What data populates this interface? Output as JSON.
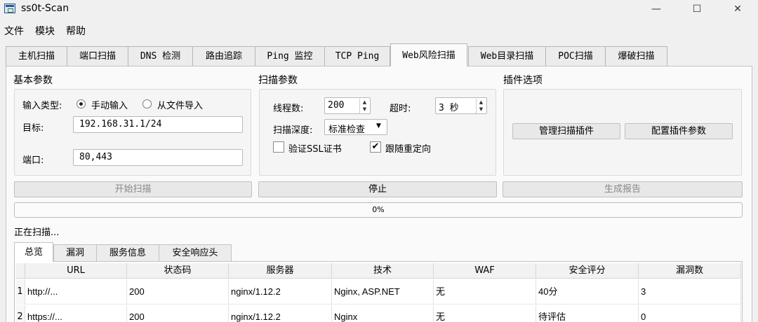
{
  "window": {
    "title": "ss0t-Scan"
  },
  "menu": [
    "文件",
    "模块",
    "帮助"
  ],
  "tabs": [
    "主机扫描",
    "端口扫描",
    "DNS 检测",
    "路由追踪",
    "Ping 监控",
    "TCP Ping",
    "Web风险扫描",
    "Web目录扫描",
    "POC扫描",
    "爆破扫描"
  ],
  "active_tab": "Web风险扫描",
  "basic": {
    "title": "基本参数",
    "input_type_label": "输入类型:",
    "radio_manual": "手动输入",
    "radio_file": "从文件导入",
    "target_label": "目标:",
    "target_value": "192.168.31.1/24",
    "port_label": "端口:",
    "port_value": "80,443"
  },
  "scan": {
    "title": "扫描参数",
    "threads_label": "线程数:",
    "threads_value": "200",
    "timeout_label": "超时:",
    "timeout_value": "3 秒",
    "depth_label": "扫描深度:",
    "depth_value": "标准检查",
    "verify_ssl_label": "验证SSL证书",
    "verify_ssl_checked": false,
    "follow_redirect_label": "跟随重定向",
    "follow_redirect_checked": true
  },
  "plugins": {
    "title": "插件选项",
    "manage_label": "管理扫描插件",
    "config_label": "配置插件参数"
  },
  "actions": {
    "start": "开始扫描",
    "stop": "停止",
    "report": "生成报告"
  },
  "progress": {
    "value": 0,
    "text": "0%"
  },
  "status_text": "正在扫描...",
  "subtabs": [
    "总览",
    "漏洞",
    "服务信息",
    "安全响应头"
  ],
  "table": {
    "headers": [
      "URL",
      "状态码",
      "服务器",
      "技术",
      "WAF",
      "安全评分",
      "漏洞数"
    ],
    "rows": [
      {
        "num": "1",
        "cells": [
          "http://...",
          "200",
          "nginx/1.12.2",
          "Nginx, ASP.NET",
          "无",
          "40分",
          "3"
        ]
      },
      {
        "num": "2",
        "cells": [
          "https://...",
          "200",
          "nginx/1.12.2",
          "Nginx",
          "无",
          "待评估",
          "0"
        ]
      }
    ]
  }
}
